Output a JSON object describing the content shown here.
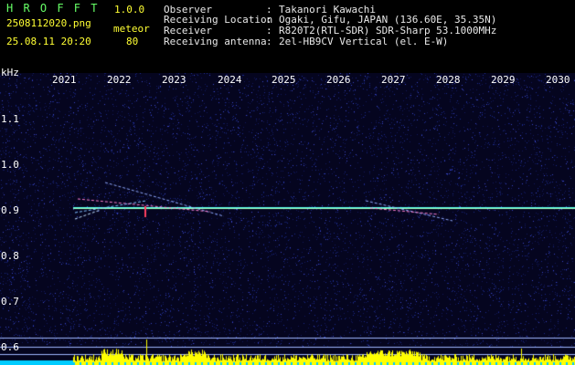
{
  "app": {
    "title": "H R O F F T",
    "version": "1.0.0",
    "filename": "2508112020.png",
    "datetime": "25.08.11 20:20",
    "mode": "meteor",
    "count": "80"
  },
  "info": [
    {
      "label": "Observer",
      "sep": ":",
      "value": "Takanori Kawachi"
    },
    {
      "label": "Receiving Location",
      "sep": ":",
      "value": "Ogaki, Gifu, JAPAN (136.60E, 35.35N)"
    },
    {
      "label": "Receiver",
      "sep": ":",
      "value": "R820T2(RTL-SDR) SDR-Sharp 53.1000MHz"
    },
    {
      "label": "Receiving antenna",
      "sep": ":",
      "value": "2el-HB9CV Vertical (el. E-W)"
    }
  ],
  "axis": {
    "unit": "kHz",
    "years": [
      "2021",
      "2022",
      "2023",
      "2024",
      "2025",
      "2026",
      "2027",
      "2028",
      "2029",
      "2030"
    ],
    "freqs": [
      "1.1",
      "1.0",
      "0.9",
      "0.8",
      "0.7",
      "0.6"
    ]
  },
  "colors": {
    "background": "#05051f",
    "header_text": "#e8e8e8",
    "title": "#66ff66",
    "meta": "#ffff33",
    "carrier": "#55ffee",
    "bars": "#ffff00",
    "baseline": "#00ccff"
  }
}
